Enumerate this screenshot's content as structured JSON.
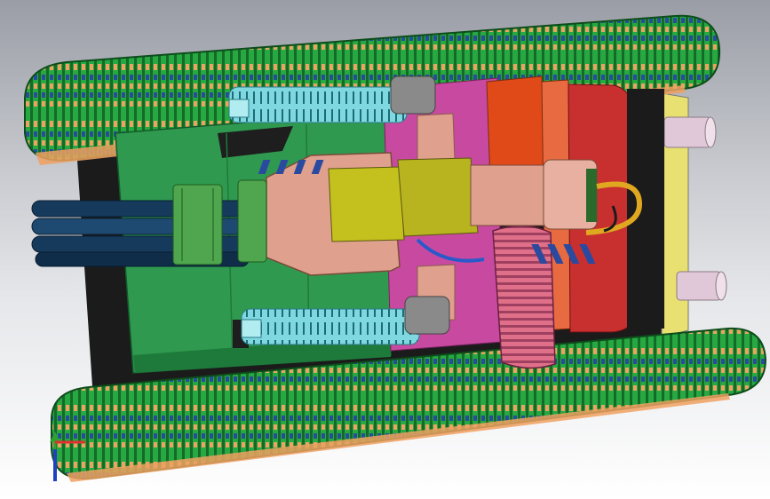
{
  "viewport": {
    "background_top": "#9a9da6",
    "background_bottom": "#ffffff"
  },
  "model": {
    "track_color": "#1f9e3a",
    "track_dark": "#136b26",
    "track_link": "#f0a060",
    "track_pin": "#2a4aa0",
    "hull_color": "#2f9a4f",
    "hull_dark": "#1e7a3a",
    "chassis_shadow": "#1b1b1b",
    "turret_color": "#e0a08e",
    "turret_dark": "#b87868",
    "barrel_color": "#163a5c",
    "barrel_clamp": "#4fa64f",
    "sight_color": "#c4c01e",
    "mount_color": "#c84aa0",
    "gear_color": "#e0708a",
    "red_block": "#c83030",
    "orange_block": "#e04a18",
    "pink_tube": "#e0c8d8",
    "cyan_cylinder": "#7fd8e0",
    "cap_color": "#8a8a8a",
    "cable_color": "#2a5ac8",
    "yellow_panel": "#e8e070"
  },
  "triad": {
    "x_color": "#e03030",
    "y_color": "#30a030",
    "z_color": "#2040c0"
  }
}
